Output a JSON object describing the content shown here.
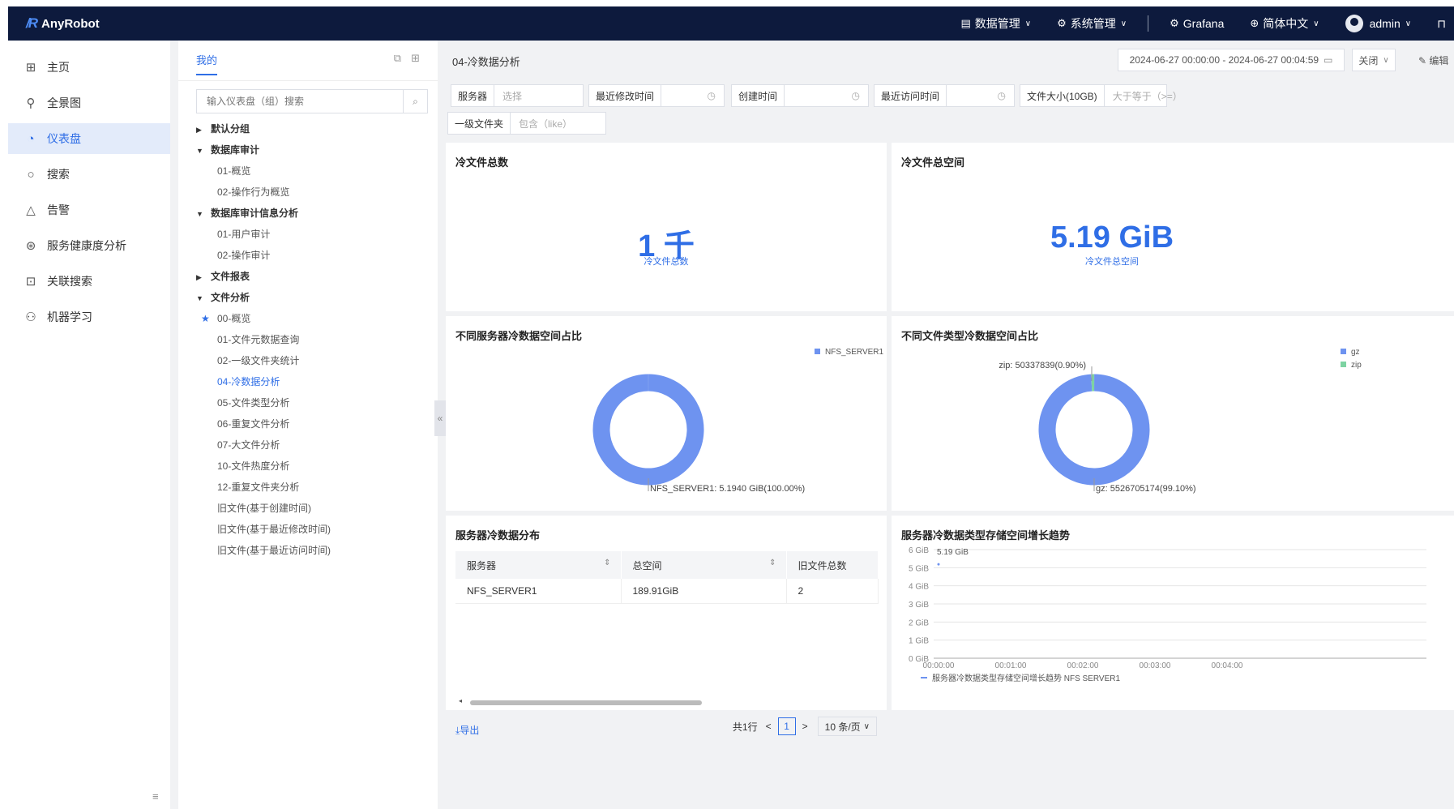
{
  "app": {
    "name": "AnyRobot"
  },
  "topnav": {
    "data_mgmt": "数据管理",
    "sys_mgmt": "系统管理",
    "grafana": "Grafana",
    "language": "简体中文",
    "user": "admin"
  },
  "sidebar": {
    "items": [
      {
        "label": "主页",
        "icon": "grid-icon"
      },
      {
        "label": "全景图",
        "icon": "topology-icon"
      },
      {
        "label": "仪表盘",
        "icon": "dashboard-icon"
      },
      {
        "label": "搜索",
        "icon": "search-icon"
      },
      {
        "label": "告警",
        "icon": "alert-icon"
      },
      {
        "label": "服务健康度分析",
        "icon": "health-icon"
      },
      {
        "label": "关联搜索",
        "icon": "link-search-icon"
      },
      {
        "label": "机器学习",
        "icon": "ml-icon"
      }
    ],
    "active_index": 2
  },
  "tree": {
    "tab": "我的",
    "search_placeholder": "输入仪表盘（组）搜索",
    "nodes": [
      {
        "label": "默认分组",
        "type": "group",
        "expanded": false
      },
      {
        "label": "数据库审计",
        "type": "group",
        "expanded": true
      },
      {
        "label": "01-概览",
        "type": "leaf"
      },
      {
        "label": "02-操作行为概览",
        "type": "leaf"
      },
      {
        "label": "数据库审计信息分析",
        "type": "group",
        "expanded": true
      },
      {
        "label": "01-用户审计",
        "type": "leaf"
      },
      {
        "label": "02-操作审计",
        "type": "leaf"
      },
      {
        "label": "文件报表",
        "type": "group",
        "expanded": false
      },
      {
        "label": "文件分析",
        "type": "group",
        "expanded": true
      },
      {
        "label": "00-概览",
        "type": "leaf",
        "starred": true
      },
      {
        "label": "01-文件元数据查询",
        "type": "leaf"
      },
      {
        "label": "02-一级文件夹统计",
        "type": "leaf"
      },
      {
        "label": "04-冷数据分析",
        "type": "leaf",
        "active": true
      },
      {
        "label": "05-文件类型分析",
        "type": "leaf"
      },
      {
        "label": "06-重复文件分析",
        "type": "leaf"
      },
      {
        "label": "07-大文件分析",
        "type": "leaf"
      },
      {
        "label": "10-文件热度分析",
        "type": "leaf"
      },
      {
        "label": "12-重复文件夹分析",
        "type": "leaf"
      },
      {
        "label": "旧文件(基于创建时间)",
        "type": "leaf"
      },
      {
        "label": "旧文件(基于最近修改时间)",
        "type": "leaf"
      },
      {
        "label": "旧文件(基于最近访问时间)",
        "type": "leaf"
      }
    ]
  },
  "main": {
    "title": "04-冷数据分析",
    "time_range": "2024-06-27 00:00:00 - 2024-06-27 00:04:59",
    "refresh": "关闭",
    "edit": "编辑"
  },
  "filters": {
    "server": {
      "label": "服务器",
      "placeholder": "选择"
    },
    "mtime": {
      "label": "最近修改时间",
      "placeholder": ""
    },
    "ctime": {
      "label": "创建时间",
      "placeholder": ""
    },
    "atime": {
      "label": "最近访问时间",
      "placeholder": ""
    },
    "size": {
      "label": "文件大小(10GB)",
      "placeholder": "大于等于（>=）"
    },
    "folder": {
      "label": "一级文件夹",
      "placeholder": "包含（like）"
    }
  },
  "cards": {
    "count": {
      "title": "冷文件总数",
      "value": "1 千",
      "sub": "冷文件总数"
    },
    "space": {
      "title": "冷文件总空间",
      "value": "5.19 GiB",
      "sub": "冷文件总空间"
    },
    "server_pie": {
      "title": "不同服务器冷数据空间占比"
    },
    "type_pie": {
      "title": "不同文件类型冷数据空间占比"
    },
    "server_table": {
      "title": "服务器冷数据分布"
    },
    "trend": {
      "title": "服务器冷数据类型存储空间增长趋势"
    }
  },
  "chart_data": [
    {
      "type": "pie",
      "title": "不同服务器冷数据空间占比",
      "legend": [
        "NFS_SERVER1"
      ],
      "slices": [
        {
          "name": "NFS_SERVER1",
          "value": 100.0,
          "label": "NFS_SERVER1: 5.1940 GiB(100.00%)",
          "color": "#6e93f0"
        }
      ],
      "legend_position": "top-right"
    },
    {
      "type": "pie",
      "title": "不同文件类型冷数据空间占比",
      "legend": [
        "gz",
        "zip"
      ],
      "slices": [
        {
          "name": "gz",
          "value": 99.1,
          "label": "gz: 5526705174(99.10%)",
          "color": "#6e93f0"
        },
        {
          "name": "zip",
          "value": 0.9,
          "label": "zip: 50337839(0.90%)",
          "color": "#7dd3a2"
        }
      ],
      "legend_position": "top-right"
    },
    {
      "type": "line",
      "title": "服务器冷数据类型存储空间增长趋势",
      "x": [
        "00:00:00",
        "00:01:00",
        "00:02:00",
        "00:03:00",
        "00:04:00"
      ],
      "yticks": [
        "0 GiB",
        "1 GiB",
        "2 GiB",
        "3 GiB",
        "4 GiB",
        "5 GiB",
        "6 GiB"
      ],
      "ylim": [
        0,
        6
      ],
      "series": [
        {
          "name": "服务器冷数据类型存储空间增长趋势 NFS SERVER1",
          "points": [
            {
              "x": "00:00:00",
              "y": 5.19
            }
          ],
          "color": "#6e93f0"
        }
      ],
      "annotation": "5.19 GiB",
      "legend_position": "bottom"
    }
  ],
  "table": {
    "columns": [
      "服务器",
      "总空间",
      "旧文件总数"
    ],
    "rows": [
      [
        "NFS_SERVER1",
        "189.91GiB",
        "2"
      ]
    ],
    "export": "导出",
    "total": "共1行",
    "page": "1",
    "page_size": "10 条/页"
  }
}
